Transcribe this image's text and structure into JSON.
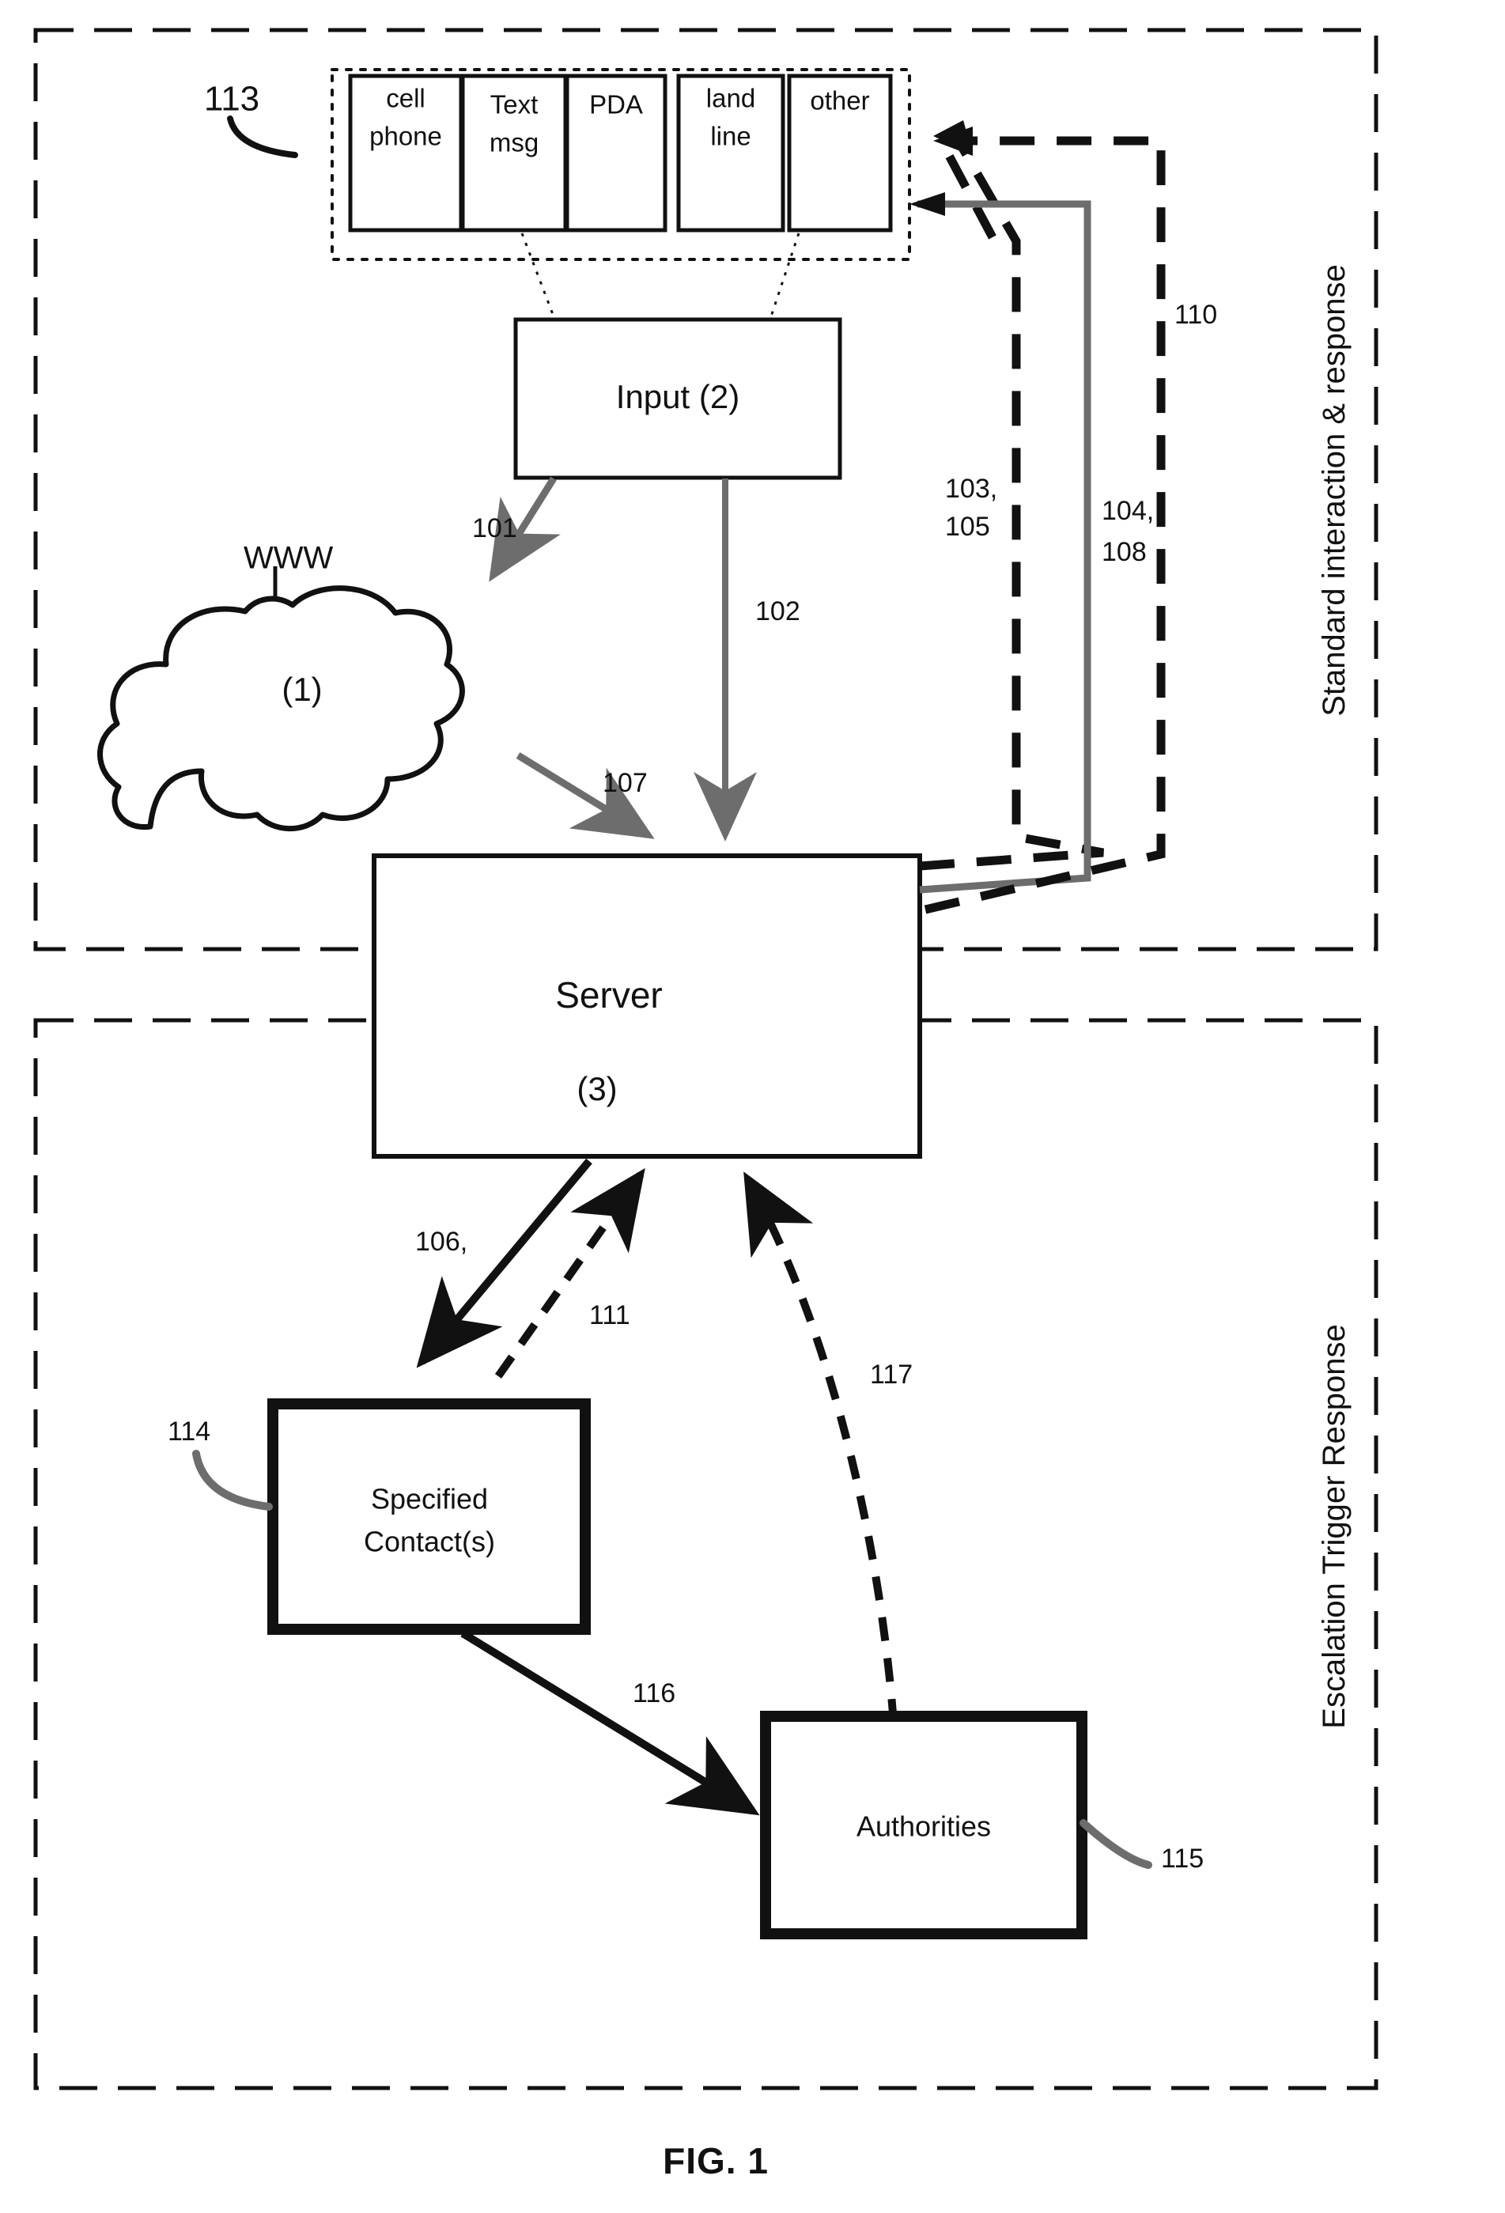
{
  "figure": {
    "caption": "FIG. 1",
    "top_reference": "113"
  },
  "sections": [
    {
      "id": "upper",
      "label": "Standard interaction & response"
    },
    {
      "id": "lower",
      "label": "Escalation Trigger Response"
    }
  ],
  "input_devices": {
    "group_reference": "113",
    "items": [
      {
        "label": "cell phone",
        "lines": [
          "cell",
          "phone"
        ]
      },
      {
        "label": "Text msg",
        "lines": [
          "Text",
          "msg"
        ]
      },
      {
        "label": "PDA",
        "lines": [
          "PDA"
        ]
      },
      {
        "label": "land line",
        "lines": [
          "land",
          "line"
        ]
      },
      {
        "label": "other",
        "lines": [
          "other"
        ]
      }
    ]
  },
  "nodes": {
    "input": {
      "label": "Input (2)",
      "number": "2"
    },
    "cloud": {
      "label": "(1)",
      "caption": "WWW",
      "number": "1"
    },
    "server": {
      "label": "Server",
      "number_label": "(3)",
      "number": "3"
    },
    "contacts": {
      "line1": "Specified",
      "line2": "Contact(s)",
      "reference": "114"
    },
    "authorities": {
      "label": "Authorities",
      "reference": "115"
    }
  },
  "connectors": [
    {
      "id": "c101",
      "label": "101",
      "from": "input",
      "to": "cloud",
      "style": "solid-gray"
    },
    {
      "id": "c102",
      "label": "102",
      "from": "input",
      "to": "server",
      "style": "solid-gray"
    },
    {
      "id": "c103_105",
      "label": "103, 105",
      "from": "server",
      "to": "devices",
      "style": "dashed-heavy"
    },
    {
      "id": "c104_108",
      "label": "104, 108",
      "from": "server",
      "to": "devices",
      "style": "solid-gray"
    },
    {
      "id": "c107",
      "label": "107",
      "from": "cloud",
      "to": "server",
      "style": "solid-gray"
    },
    {
      "id": "c110",
      "label": "110",
      "from": "server",
      "to": "devices",
      "style": "dashed-heavy"
    },
    {
      "id": "c106",
      "label": "106,",
      "from": "server",
      "to": "contacts",
      "style": "solid-black"
    },
    {
      "id": "c111",
      "label": "111",
      "from": "contacts",
      "to": "server",
      "style": "dashed-black"
    },
    {
      "id": "c116",
      "label": "116",
      "from": "contacts",
      "to": "authorities",
      "style": "solid-black"
    },
    {
      "id": "c117",
      "label": "117",
      "from": "authorities",
      "to": "server",
      "style": "dashed-black"
    }
  ],
  "reference_numerals": {
    "n101": "101",
    "n102": "102",
    "n103_105": "103,\n105",
    "n103": "103,",
    "n105": "105",
    "n104": "104,",
    "n108": "108",
    "n106": "106,",
    "n107": "107",
    "n110": "110",
    "n111": "111",
    "n113": "113",
    "n114": "114",
    "n115": "115",
    "n116": "116",
    "n117": "117"
  },
  "colors": {
    "ink": "#111111",
    "gray_connector": "#6d6d6d",
    "background": "#ffffff"
  }
}
